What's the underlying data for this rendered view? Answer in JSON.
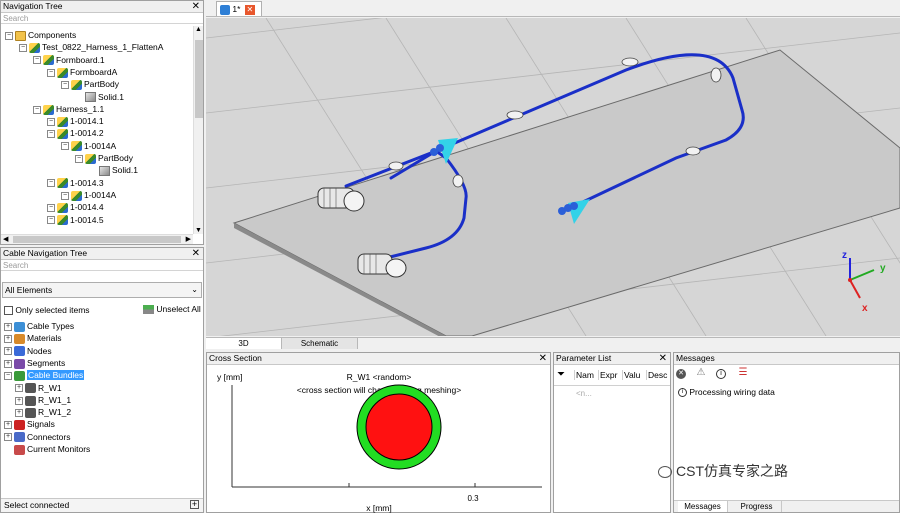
{
  "nav_tree": {
    "title": "Navigation Tree",
    "search_placeholder": "Search",
    "items": [
      {
        "label": "Components",
        "level": 0,
        "icon": "folder"
      },
      {
        "label": "Test_0822_Harness_1_FlattenA",
        "level": 1,
        "icon": "part"
      },
      {
        "label": "Formboard.1",
        "level": 2,
        "icon": "part"
      },
      {
        "label": "FormboardA",
        "level": 3,
        "icon": "part"
      },
      {
        "label": "PartBody",
        "level": 4,
        "icon": "part"
      },
      {
        "label": "Solid.1",
        "level": 5,
        "icon": "solid"
      },
      {
        "label": "Harness_1.1",
        "level": 2,
        "icon": "part"
      },
      {
        "label": "1-0014.1",
        "level": 3,
        "icon": "part"
      },
      {
        "label": "1-0014.2",
        "level": 3,
        "icon": "part"
      },
      {
        "label": "1-0014A",
        "level": 4,
        "icon": "part"
      },
      {
        "label": "PartBody",
        "level": 5,
        "icon": "part"
      },
      {
        "label": "Solid.1",
        "level": 6,
        "icon": "solid"
      },
      {
        "label": "1-0014.3",
        "level": 3,
        "icon": "part"
      },
      {
        "label": "1-0014A",
        "level": 4,
        "icon": "part"
      },
      {
        "label": "1-0014.4",
        "level": 3,
        "icon": "part"
      },
      {
        "label": "1-0014.5",
        "level": 3,
        "icon": "part"
      }
    ]
  },
  "cable_nav": {
    "title": "Cable Navigation Tree",
    "search_placeholder": "Search",
    "filter_value": "All Elements",
    "only_selected_label": "Only selected items",
    "unselect_all_label": "Unselect All",
    "items": [
      {
        "label": "Cable Types",
        "level": 0,
        "icon": "cable-types",
        "selected": false
      },
      {
        "label": "Materials",
        "level": 0,
        "icon": "materials",
        "selected": false
      },
      {
        "label": "Nodes",
        "level": 0,
        "icon": "nodes",
        "selected": false
      },
      {
        "label": "Segments",
        "level": 0,
        "icon": "segments",
        "selected": false
      },
      {
        "label": "Cable Bundles",
        "level": 0,
        "icon": "cable-bundles",
        "selected": true
      },
      {
        "label": "R_W1",
        "level": 1,
        "icon": "bundle",
        "selected": false
      },
      {
        "label": "R_W1_1",
        "level": 1,
        "icon": "bundle",
        "selected": false
      },
      {
        "label": "R_W1_2",
        "level": 1,
        "icon": "bundle",
        "selected": false
      },
      {
        "label": "Signals",
        "level": 0,
        "icon": "signals",
        "selected": false
      },
      {
        "label": "Connectors",
        "level": 0,
        "icon": "connectors",
        "selected": false
      },
      {
        "label": "Current Monitors",
        "level": 0,
        "icon": "monitors",
        "selected": false
      }
    ],
    "select_connected_label": "Select connected"
  },
  "doc_tab": {
    "label": "1*"
  },
  "view_tabs": [
    {
      "label": "3D",
      "active": true
    },
    {
      "label": "Schematic",
      "active": false
    }
  ],
  "axes": {
    "z": "z",
    "y": "y",
    "x": "x"
  },
  "cross_section": {
    "title": "Cross Section",
    "ylabel": "y [mm]",
    "xlabel": "x [mm]",
    "heading": "R_W1 <random>",
    "subheading": "<cross section will change during meshing>",
    "tick": "0.3",
    "outer_color": "#22dd22",
    "inner_color": "#ff1111"
  },
  "param_list": {
    "title": "Parameter List",
    "columns": [
      "Nam",
      "Expr",
      "Valu",
      "Desc"
    ],
    "placeholder": "<n..."
  },
  "messages": {
    "title": "Messages",
    "lines": [
      "Processing wiring data"
    ],
    "tabs": [
      "Messages",
      "Progress"
    ],
    "watermark": "CST仿真专家之路"
  },
  "colors": {
    "cable": "#1a2fc8",
    "board": "#c9c9c9",
    "viewport_bg": "#d6d6d6",
    "selection": "#3399ff"
  }
}
